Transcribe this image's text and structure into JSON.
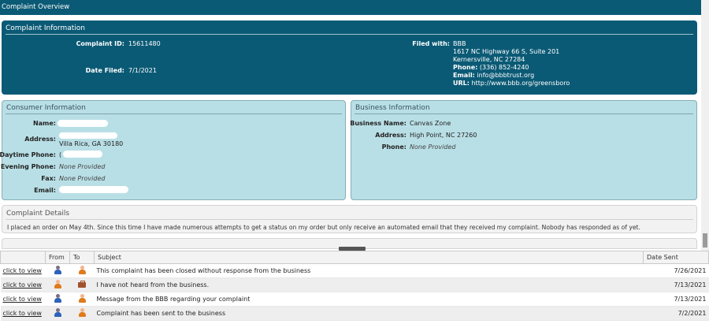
{
  "window": {
    "title": "Complaint Overview"
  },
  "complaint_info": {
    "header": "Complaint Information",
    "complaint_id_label": "Complaint ID:",
    "complaint_id": "15611480",
    "date_filed_label": "Date Filed:",
    "date_filed": "7/1/2021",
    "filed_with_label": "Filed with:",
    "filed_with_name": "BBB",
    "filed_with_street": "1617 NC Highway 66 S, Suite 201",
    "filed_with_city": "Kernersville, NC 27284",
    "phone_label": "Phone:",
    "phone": "(336) 852-4240",
    "email_label": "Email:",
    "email": "info@bbbtrust.org",
    "url_label": "URL:",
    "url": "http://www.bbb.org/greensboro"
  },
  "consumer": {
    "header": "Consumer Information",
    "name_label": "Name:",
    "address_label": "Address:",
    "address_city": "Villa Rica, GA 30180",
    "daytime_label": "Daytime Phone:",
    "daytime_partial": "(",
    "evening_label": "Evening Phone:",
    "evening": "None Provided",
    "fax_label": "Fax:",
    "fax": "None Provided",
    "email_label": "Email:"
  },
  "business": {
    "header": "Business Information",
    "name_label": "Business Name:",
    "name": "Canvas Zone",
    "address_label": "Address:",
    "address": "High Point, NC 27260",
    "phone_label": "Phone:",
    "phone": "None Provided"
  },
  "details": {
    "header": "Complaint Details",
    "text": "I placed an order on May 4th. Since this time I have made numerous attempts to get a status on my order but only receive an automated email that they received my complaint. Nobody has responded as of yet."
  },
  "messages": {
    "columns": {
      "from": "From",
      "to": "To",
      "subject": "Subject",
      "date": "Date Sent"
    },
    "rows": [
      {
        "link": "click to view",
        "from_icon": "consumer-icon",
        "to_icon": "bbb-agent-icon",
        "subject": "This complaint has been closed without response from the business",
        "date": "7/26/2021"
      },
      {
        "link": "click to view",
        "from_icon": "bbb-agent-icon",
        "to_icon": "business-briefcase-icon",
        "subject": "I have not heard from the business.",
        "date": "7/13/2021"
      },
      {
        "link": "click to view",
        "from_icon": "consumer-icon",
        "to_icon": "bbb-agent-icon",
        "subject": "Message from the BBB regarding your complaint",
        "date": "7/13/2021"
      },
      {
        "link": "click to view",
        "from_icon": "consumer-icon",
        "to_icon": "bbb-agent-icon",
        "subject": "Complaint has been sent to the business",
        "date": "7/2/2021"
      }
    ]
  },
  "colors": {
    "dark_panel": "#0b5a75",
    "light_panel": "#b9dfe6"
  }
}
